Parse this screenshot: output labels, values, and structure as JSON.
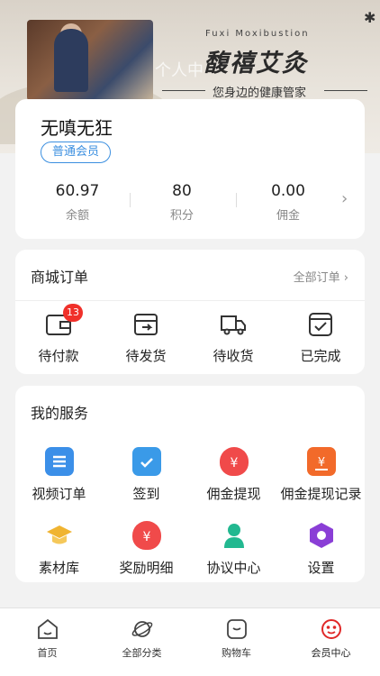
{
  "banner": {
    "title_en": "Fuxi Moxibustion",
    "title_cn": "馥禧艾灸",
    "ghost_text": "个人中",
    "slogan": "您身边的健康管家"
  },
  "user": {
    "name": "无嗔无狂",
    "member_level": "普通会员",
    "stats": [
      {
        "value": "60.97",
        "label": "余额"
      },
      {
        "value": "80",
        "label": "积分"
      },
      {
        "value": "0.00",
        "label": "佣金"
      }
    ]
  },
  "orders": {
    "title": "商城订单",
    "all_link": "全部订单",
    "items": [
      {
        "label": "待付款",
        "badge": "13",
        "icon": "wallet-icon"
      },
      {
        "label": "待发货",
        "icon": "package-out-icon"
      },
      {
        "label": "待收货",
        "icon": "truck-icon"
      },
      {
        "label": "已完成",
        "icon": "check-box-icon"
      }
    ]
  },
  "services": {
    "title": "我的服务",
    "items": [
      {
        "label": "视频订单",
        "icon": "list-doc-icon",
        "color": "#3b8fe8"
      },
      {
        "label": "签到",
        "icon": "calendar-check-icon",
        "color": "#3a9ae8"
      },
      {
        "label": "佣金提现",
        "icon": "money-bag-icon",
        "color": "#f04a4a"
      },
      {
        "label": "佣金提现记录",
        "icon": "record-icon",
        "color": "#f26a2a"
      },
      {
        "label": "素材库",
        "icon": "graduation-cap-icon",
        "color": "#f0b431"
      },
      {
        "label": "奖励明细",
        "icon": "money-bag-icon",
        "color": "#f04a4a"
      },
      {
        "label": "协议中心",
        "icon": "person-icon",
        "color": "#22b890"
      },
      {
        "label": "设置",
        "icon": "hexagon-settings-icon",
        "color": "#8a3ed6"
      }
    ]
  },
  "tabbar": {
    "items": [
      {
        "label": "首页",
        "icon": "home-icon"
      },
      {
        "label": "全部分类",
        "icon": "planet-icon"
      },
      {
        "label": "购物车",
        "icon": "cart-box-icon"
      },
      {
        "label": "会员中心",
        "icon": "member-face-icon",
        "active": true
      }
    ],
    "active_color": "#e02828"
  }
}
